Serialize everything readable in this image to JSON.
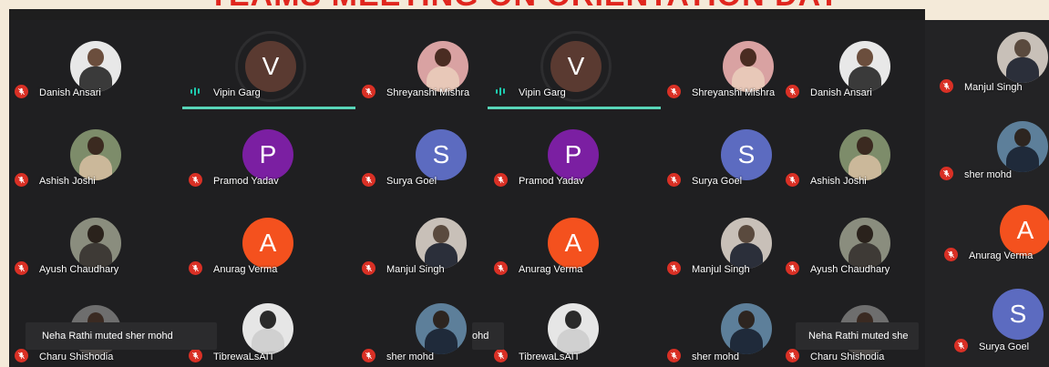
{
  "banner": {
    "title": "TEAMS MEETING ON ORIENTATION DAY"
  },
  "participants": {
    "danish_1": "Danish Ansari",
    "vipin_1": "Vipin Garg",
    "shreyanshi_1": "Shreyanshi Mishra",
    "vipin_2": "Vipin Garg",
    "shreyanshi_2": "Shreyanshi Mishra",
    "danish_2": "Danish Ansari",
    "manjul_r": "Manjul Singh",
    "ashish_1": "Ashish Joshi",
    "pramod_1": "Pramod Yadav",
    "surya_1": "Surya Goel",
    "pramod_2": "Pramod Yadav",
    "surya_2": "Surya Goel",
    "ashish_2": "Ashish Joshi",
    "sher_r": "sher mohd",
    "ayush_1": "Ayush Chaudhary",
    "anurag_1": "Anurag Verma",
    "manjul_1": "Manjul Singh",
    "anurag_2": "Anurag Verma",
    "manjul_2": "Manjul Singh",
    "ayush_2": "Ayush Chaudhary",
    "anurag_r": "Anurag Verma",
    "charu_1": "Charu Shishodia",
    "tibrewal_1": "TibrewaLsAIT",
    "sher_1": "sher mohd",
    "tibrewal_2": "TibrewaLsAIT",
    "sher_2": "sher mohd",
    "charu_2": "Charu Shishodia",
    "surya_r": "Surya Goel"
  },
  "avatar_letters": {
    "vipin": "V",
    "pramod": "P",
    "surya": "S",
    "anurag": "A"
  },
  "notifications": {
    "toast_1": "Neha Rathi muted sher mohd",
    "toast_2_fragment": "ohd",
    "toast_3": "Neha Rathi muted she"
  },
  "colors": {
    "mute_red": "#d93025",
    "active_speaker_teal": "#58d5b8",
    "avatar_vipin": "#5a3a31",
    "avatar_pramod": "#7b1fa2",
    "avatar_surya": "#5c6bc0",
    "avatar_anurag": "#f4511e",
    "banner_red": "#e0261e"
  },
  "icons": {
    "muted": "mic-off-icon",
    "speaking": "audio-level-icon"
  }
}
